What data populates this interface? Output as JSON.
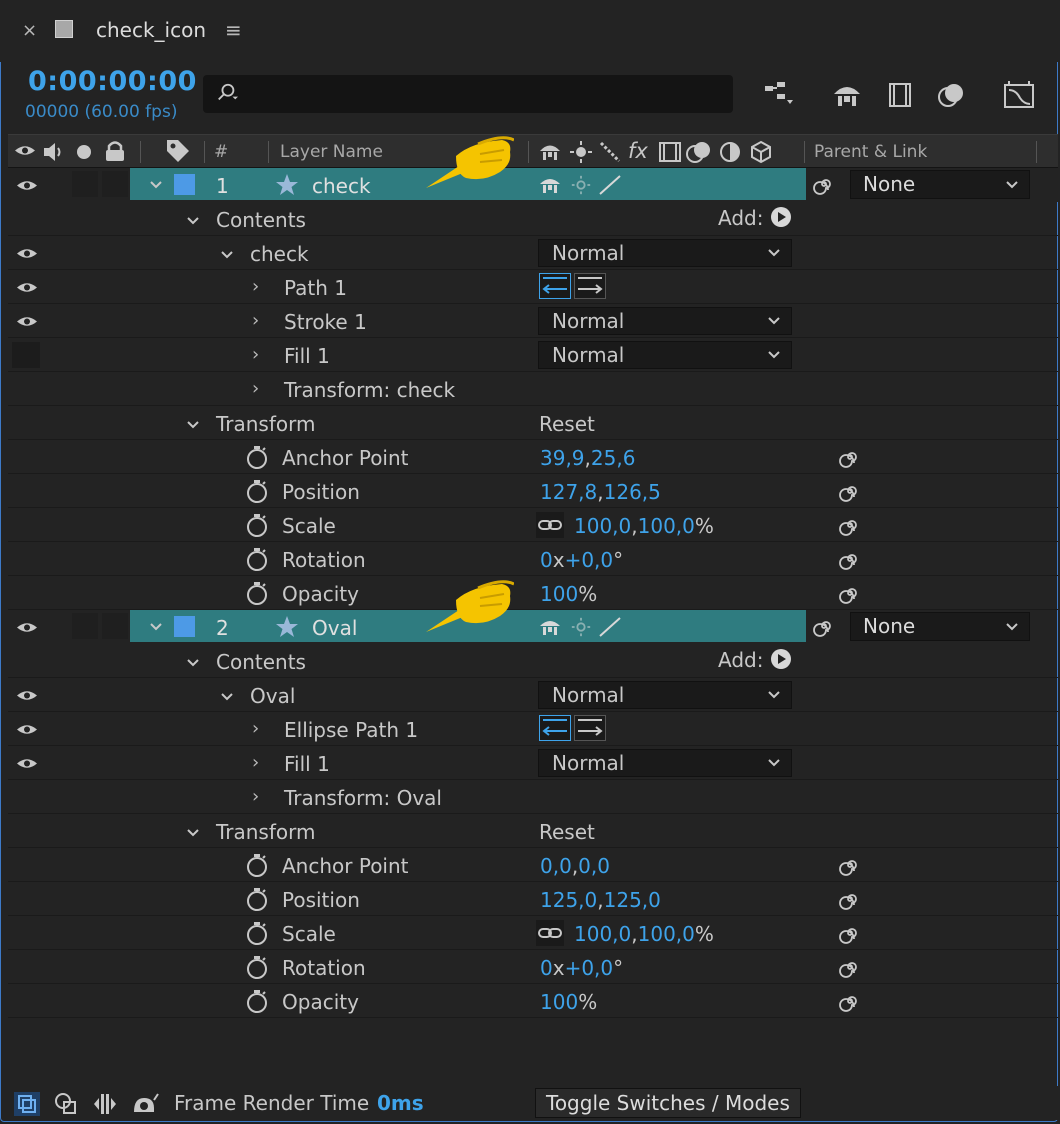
{
  "tab": {
    "close": "×",
    "title": "check_icon",
    "menu": "≡"
  },
  "timecode": {
    "time": "0:00:00:00",
    "frames": "00000 (60.00 fps)"
  },
  "search": {
    "placeholder": ""
  },
  "columns": {
    "hash": "#",
    "layer_name": "Layer Name",
    "parent_link": "Parent & Link",
    "fx": "fx"
  },
  "layers": [
    {
      "number": "1",
      "name": "check",
      "parent": "None",
      "contents_label": "Contents",
      "add_label": "Add:",
      "group": {
        "name": "check",
        "mode": "Normal"
      },
      "group_items": [
        {
          "name": "Path 1"
        },
        {
          "name": "Stroke 1",
          "mode": "Normal"
        },
        {
          "name": "Fill 1",
          "mode": "Normal"
        },
        {
          "name": "Transform: check"
        }
      ],
      "transform": {
        "label": "Transform",
        "reset": "Reset",
        "props": [
          {
            "name": "Anchor Point",
            "v1": "39,9",
            "sep": ",",
            "v2": "25,6",
            "unit": ""
          },
          {
            "name": "Position",
            "v1": "127,8",
            "sep": ",",
            "v2": "126,5",
            "unit": ""
          },
          {
            "name": "Scale",
            "v1": "100,0",
            "sep": ",",
            "v2": "100,0",
            "unit": "%"
          },
          {
            "name": "Rotation",
            "v1": "0",
            "sep": "x",
            "v2": "+0,0",
            "unit": "°"
          },
          {
            "name": "Opacity",
            "v1": "100",
            "sep": "",
            "v2": "",
            "unit": "%"
          }
        ]
      }
    },
    {
      "number": "2",
      "name": "Oval",
      "parent": "None",
      "contents_label": "Contents",
      "add_label": "Add:",
      "group": {
        "name": "Oval",
        "mode": "Normal"
      },
      "group_items": [
        {
          "name": "Ellipse Path 1"
        },
        {
          "name": "Fill 1",
          "mode": "Normal"
        },
        {
          "name": "Transform: Oval"
        }
      ],
      "transform": {
        "label": "Transform",
        "reset": "Reset",
        "props": [
          {
            "name": "Anchor Point",
            "v1": "0,0",
            "sep": ",",
            "v2": "0,0",
            "unit": ""
          },
          {
            "name": "Position",
            "v1": "125,0",
            "sep": ",",
            "v2": "125,0",
            "unit": ""
          },
          {
            "name": "Scale",
            "v1": "100,0",
            "sep": ",",
            "v2": "100,0",
            "unit": "%"
          },
          {
            "name": "Rotation",
            "v1": "0",
            "sep": "x",
            "v2": "+0,0",
            "unit": "°"
          },
          {
            "name": "Opacity",
            "v1": "100",
            "sep": "",
            "v2": "",
            "unit": "%"
          }
        ]
      }
    }
  ],
  "footer": {
    "render_label": "Frame Render Time",
    "render_value": "0ms",
    "toggle": "Toggle Switches / Modes"
  },
  "colors": {
    "accent": "#3ea3ea",
    "layer_bar": "#2f7c80",
    "label_blue": "#4d9ae6",
    "pointer": "#f5c400"
  }
}
